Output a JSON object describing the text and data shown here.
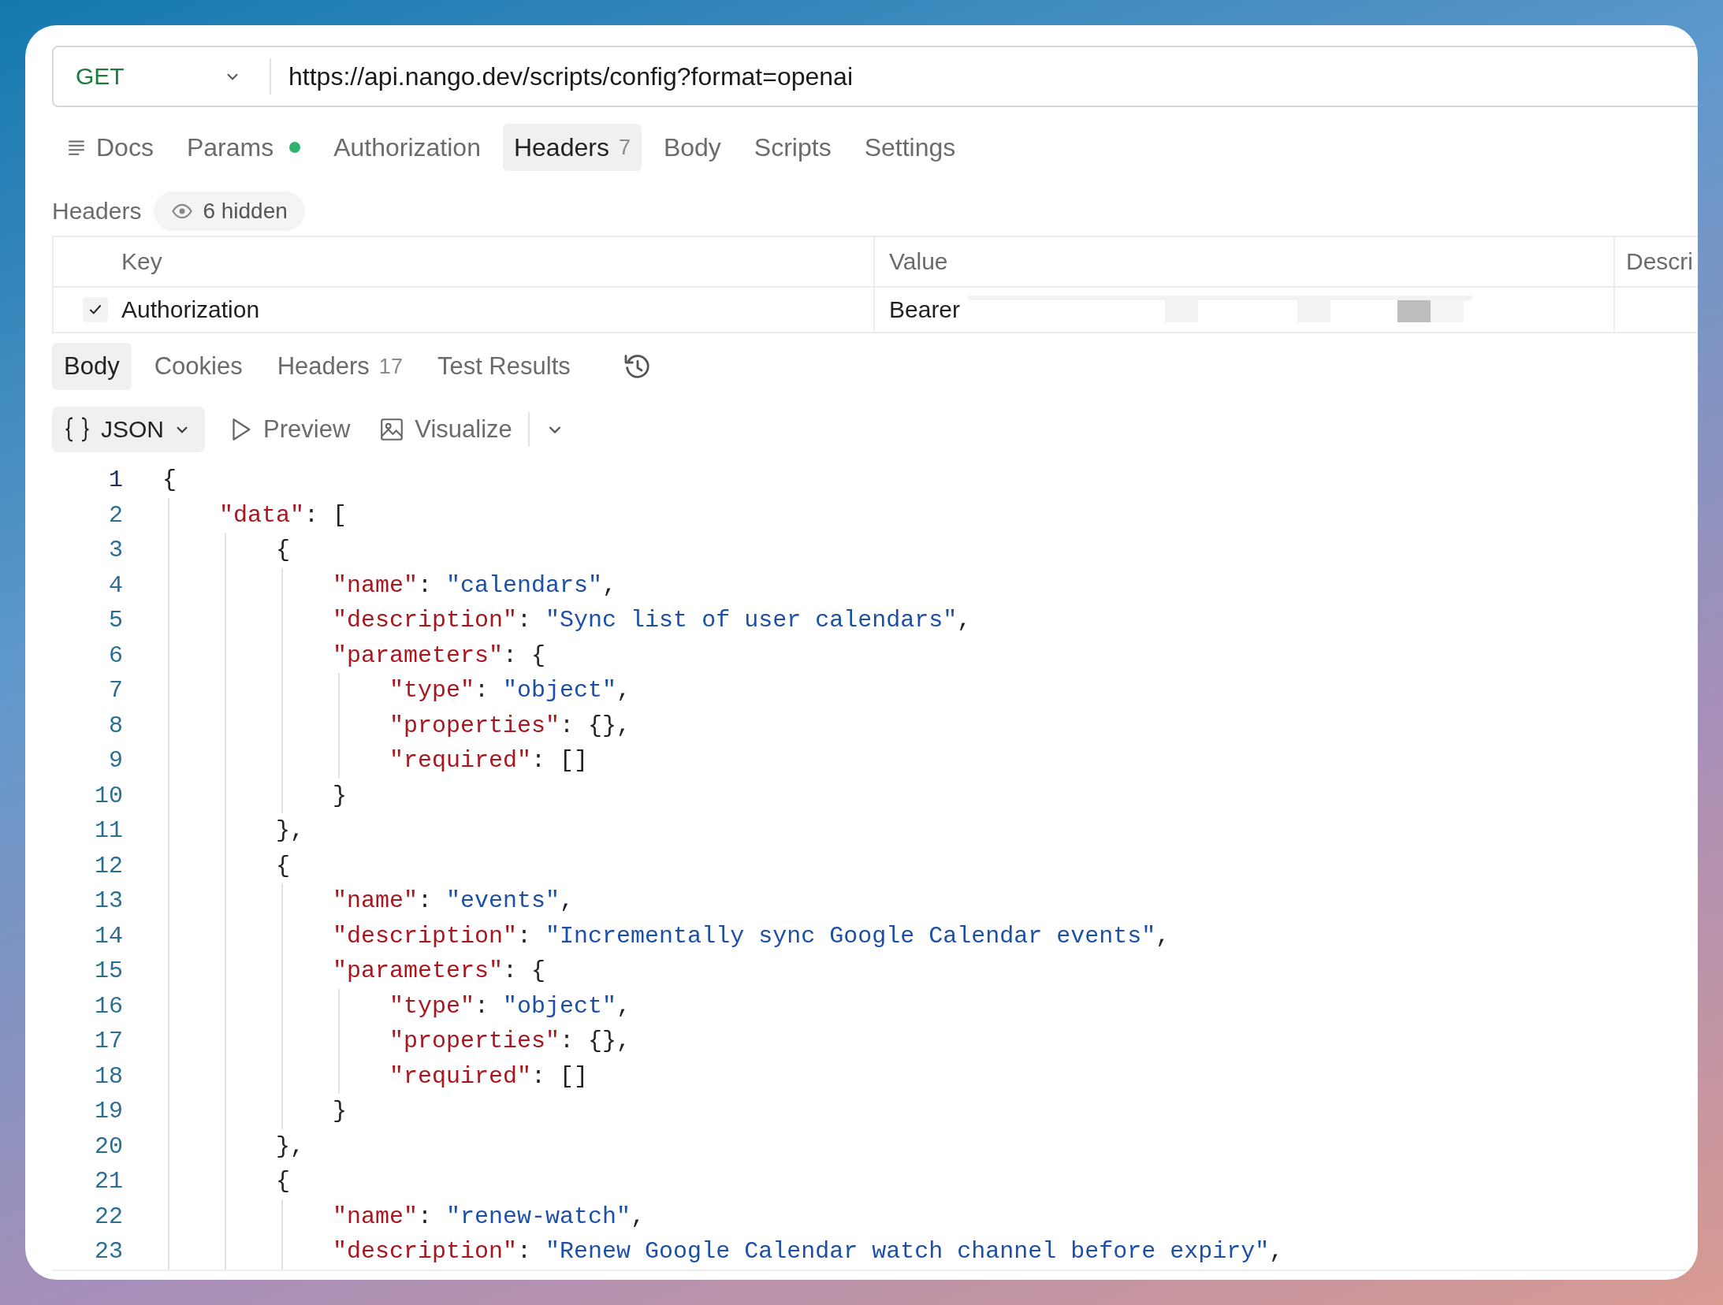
{
  "request": {
    "method": "GET",
    "url": "https://api.nango.dev/scripts/config?format=openai"
  },
  "request_tabs": [
    {
      "label": "Docs",
      "kind": "docs",
      "selected": false
    },
    {
      "label": "Params",
      "kind": "dot",
      "selected": false
    },
    {
      "label": "Authorization",
      "kind": "plain",
      "selected": false
    },
    {
      "label": "Headers",
      "kind": "count",
      "count": "7",
      "selected": true
    },
    {
      "label": "Body",
      "kind": "plain",
      "selected": false
    },
    {
      "label": "Scripts",
      "kind": "plain",
      "selected": false
    },
    {
      "label": "Settings",
      "kind": "plain",
      "selected": false
    }
  ],
  "headers": {
    "title": "Headers",
    "hidden_label": "6 hidden",
    "columns": [
      "Key",
      "Value",
      "Descri"
    ],
    "rows": [
      {
        "checked": true,
        "key": "Authorization",
        "value": "Bearer"
      }
    ]
  },
  "response_tabs": [
    {
      "label": "Body",
      "selected": true
    },
    {
      "label": "Cookies",
      "selected": false
    },
    {
      "label": "Headers",
      "count": "17",
      "selected": false
    },
    {
      "label": "Test Results",
      "selected": false
    }
  ],
  "view_toolbar": {
    "format": "JSON",
    "preview": "Preview",
    "visualize": "Visualize"
  },
  "code_lines": [
    {
      "number": "1",
      "text": "{",
      "active": true
    },
    {
      "number": "2",
      "text": "    \"data\": [",
      "active": false
    },
    {
      "number": "3",
      "text": "        {",
      "active": false
    },
    {
      "number": "4",
      "text": "            \"name\": \"calendars\",",
      "active": false
    },
    {
      "number": "5",
      "text": "            \"description\": \"Sync list of user calendars\",",
      "active": false
    },
    {
      "number": "6",
      "text": "            \"parameters\": {",
      "active": false
    },
    {
      "number": "7",
      "text": "                \"type\": \"object\",",
      "active": false
    },
    {
      "number": "8",
      "text": "                \"properties\": {},",
      "active": false
    },
    {
      "number": "9",
      "text": "                \"required\": []",
      "active": false
    },
    {
      "number": "10",
      "text": "            }",
      "active": false
    },
    {
      "number": "11",
      "text": "        },",
      "active": false
    },
    {
      "number": "12",
      "text": "        {",
      "active": false
    },
    {
      "number": "13",
      "text": "            \"name\": \"events\",",
      "active": false
    },
    {
      "number": "14",
      "text": "            \"description\": \"Incrementally sync Google Calendar events\",",
      "active": false
    },
    {
      "number": "15",
      "text": "            \"parameters\": {",
      "active": false
    },
    {
      "number": "16",
      "text": "                \"type\": \"object\",",
      "active": false
    },
    {
      "number": "17",
      "text": "                \"properties\": {},",
      "active": false
    },
    {
      "number": "18",
      "text": "                \"required\": []",
      "active": false
    },
    {
      "number": "19",
      "text": "            }",
      "active": false
    },
    {
      "number": "20",
      "text": "        },",
      "active": false
    },
    {
      "number": "21",
      "text": "        {",
      "active": false
    },
    {
      "number": "22",
      "text": "            \"name\": \"renew-watch\",",
      "active": false
    },
    {
      "number": "23",
      "text": "            \"description\": \"Renew Google Calendar watch channel before expiry\",",
      "active": false
    }
  ]
}
